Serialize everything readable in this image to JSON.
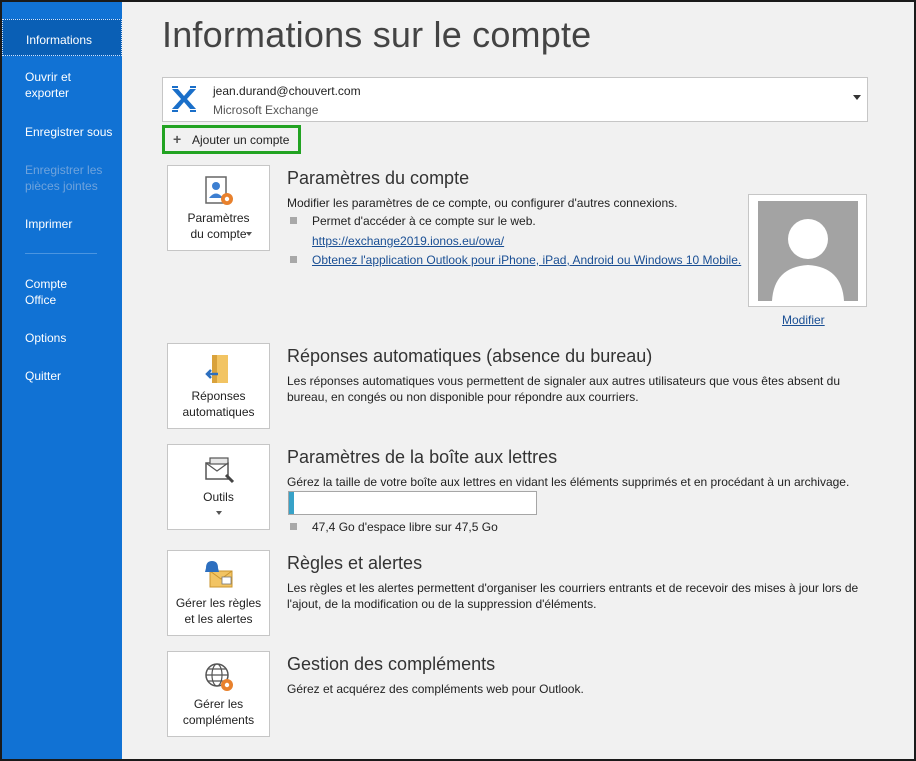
{
  "sidebar": {
    "items": [
      {
        "label": "Informations",
        "active": true
      },
      {
        "label": "Ouvrir et exporter"
      },
      {
        "label": "Enregistrer sous"
      },
      {
        "label": "Enregistrer les pièces jointes",
        "disabled": true
      },
      {
        "label": "Imprimer"
      },
      {
        "label": "Compte Office"
      },
      {
        "label": "Options"
      },
      {
        "label": "Quitter"
      }
    ]
  },
  "page": {
    "title": "Informations sur le compte"
  },
  "account": {
    "email": "jean.durand@chouvert.com",
    "type": "Microsoft Exchange",
    "icon": "exchange-icon"
  },
  "add_account": {
    "label": "Ajouter un compte"
  },
  "sections": {
    "account_settings": {
      "tile_line1": "Paramètres",
      "tile_line2": "du compte",
      "title": "Paramètres du compte",
      "desc": "Modifier les paramètres de ce compte, ou configurer d'autres connexions.",
      "bullet1": "Permet d'accéder à ce compte sur le web.",
      "link1": "https://exchange2019.ionos.eu/owa/",
      "link2": "Obtenez l'application Outlook pour iPhone, iPad, Android ou Windows 10 Mobile.",
      "photo_modify": "Modifier"
    },
    "auto_replies": {
      "tile_line1": "Réponses",
      "tile_line2": "automatiques",
      "title": "Réponses automatiques (absence du bureau)",
      "desc_line1": "Les réponses automatiques vous permettent de signaler aux autres utilisateurs que vous êtes absent du",
      "desc_line2": "bureau, en congés ou non disponible pour répondre aux courriers."
    },
    "mailbox": {
      "tile_line1": "Outils",
      "title": "Paramètres de la boîte aux lettres",
      "desc": "Gérez la taille de votre boîte aux lettres en vidant les éléments supprimés et en procédant à un archivage.",
      "storage_text": "47,4 Go d'espace libre sur 47,5 Go",
      "used_fraction": 0.02
    },
    "rules": {
      "tile_line1": "Gérer les règles",
      "tile_line2": "et les alertes",
      "title": "Règles et alertes",
      "desc_line1": "Les règles et les alertes permettent d'organiser les courriers entrants et de recevoir des mises à jour lors de",
      "desc_line2": "l'ajout, de la modification ou de la suppression d'éléments."
    },
    "addins": {
      "tile_line1": "Gérer les",
      "tile_line2": "compléments",
      "title": "Gestion des compléments",
      "desc": "Gérez et acquérez des compléments web pour Outlook."
    }
  },
  "colors": {
    "sidebar": "#1172d4",
    "accent_link": "#1a4f94",
    "highlight": "#22a322",
    "storage": "#37a2c8"
  }
}
